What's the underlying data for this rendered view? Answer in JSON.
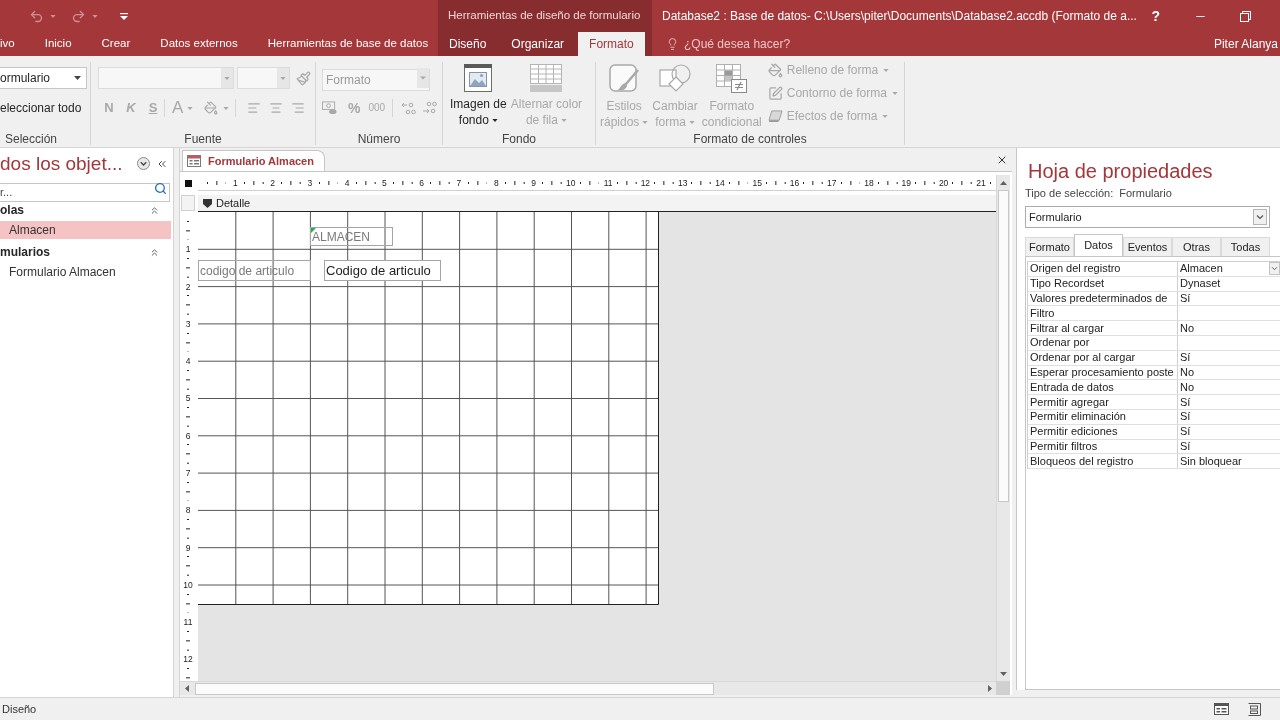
{
  "title_bar": {
    "context_group": "Herramientas de diseño de formulario",
    "title": "Database2 : Base de datos- C:\\Users\\piter\\Documents\\Database2.accdb (Formato de a...",
    "help": "?"
  },
  "tabs": [
    {
      "label": "ivo",
      "selected": false
    },
    {
      "label": "Inicio",
      "selected": false
    },
    {
      "label": "Crear",
      "selected": false
    },
    {
      "label": "Datos externos",
      "selected": false
    },
    {
      "label": "Herramientas de base de datos",
      "selected": false
    }
  ],
  "context_tabs": [
    {
      "label": "Diseño",
      "selected": false
    },
    {
      "label": "Organizar",
      "selected": false
    },
    {
      "label": "Formato",
      "selected": true
    }
  ],
  "tell_me": {
    "placeholder": "¿Qué desea hacer?"
  },
  "account": {
    "name": "Piter Alanya"
  },
  "ribbon_groups": [
    {
      "kind": "selection",
      "label": "Selección",
      "object_dropdown": "ormulario",
      "select_all": "eleccionar todo"
    },
    {
      "kind": "font",
      "label": "Fuente",
      "disabled": true,
      "style_buttons": [
        "N",
        "K",
        "S"
      ],
      "font_color": "A"
    },
    {
      "kind": "number",
      "label": "Número",
      "disabled": true,
      "format_field": {
        "placeholder": "Formato"
      },
      "percent": "%",
      "thousands": "000"
    },
    {
      "kind": "background",
      "label": "Fondo",
      "buttons": [
        {
          "lines": [
            "Imagen de",
            "fondo"
          ],
          "disabled": false,
          "dropdown": true
        },
        {
          "lines": [
            "Alternar color",
            "de fila"
          ],
          "disabled": true,
          "dropdown": true
        }
      ]
    },
    {
      "kind": "control_format",
      "label": "Formato de controles",
      "large_buttons": [
        {
          "lines": [
            "Estilos",
            "rápidos"
          ],
          "disabled": true,
          "dropdown": true
        },
        {
          "lines": [
            "Cambiar",
            "forma"
          ],
          "disabled": true,
          "dropdown": true
        },
        {
          "lines": [
            "Formato",
            "condicional"
          ],
          "disabled": true,
          "dropdown": false
        }
      ],
      "small_buttons": [
        {
          "label": "Relleno de forma",
          "disabled": true,
          "dropdown": true
        },
        {
          "label": "Contorno de forma",
          "disabled": true,
          "dropdown": true
        },
        {
          "label": "Efectos de forma",
          "disabled": true,
          "dropdown": true
        }
      ]
    }
  ],
  "nav_pane": {
    "title": "dos los objet...",
    "search": {
      "placeholder": "r..."
    },
    "groups": [
      {
        "label": "olas",
        "expanded": true,
        "items": [
          {
            "label": "Almacen",
            "selected": true
          }
        ]
      },
      {
        "label": "mularios",
        "expanded": true,
        "items": [
          {
            "label": "Formulario Almacen",
            "selected": false
          }
        ]
      }
    ]
  },
  "document": {
    "tabs": [
      {
        "label": "Formulario Almacen",
        "selected": true
      }
    ],
    "ruler": [
      "1",
      "2",
      "3",
      "4",
      "5",
      "6",
      "7",
      "8",
      "9",
      "10",
      "11",
      "12",
      "13",
      "14",
      "15",
      "16",
      "17",
      "18",
      "19",
      "20",
      "21"
    ],
    "vertical_ruler": [
      "1",
      "2",
      "3",
      "4",
      "5",
      "6",
      "7",
      "8",
      "9",
      "10",
      "11",
      "12"
    ],
    "section": "Detalle",
    "controls": [
      {
        "kind": "label",
        "text": "ALMACEN",
        "error_flag": true
      },
      {
        "kind": "label",
        "text": "codigo de articulo",
        "error_flag": false
      },
      {
        "kind": "textbox",
        "text": "Codigo de articulo",
        "error_flag": false
      }
    ]
  },
  "property_sheet": {
    "title": "Hoja de propiedades",
    "selection_type_label": "Tipo de selección:",
    "selection_type": "Formulario",
    "object_selector": "Formulario",
    "tabs": [
      {
        "label": "Formato",
        "selected": false
      },
      {
        "label": "Datos",
        "selected": true
      },
      {
        "label": "Eventos",
        "selected": false
      },
      {
        "label": "Otras",
        "selected": false
      },
      {
        "label": "Todas",
        "selected": false
      }
    ],
    "rows": [
      {
        "name": "Origen del registro",
        "value": "Almacen",
        "focused": true
      },
      {
        "name": "Tipo Recordset",
        "value": "Dynaset",
        "focused": false
      },
      {
        "name": "Valores predeterminados de",
        "value": "Sí",
        "focused": false
      },
      {
        "name": "Filtro",
        "focused": false
      },
      {
        "name": "Filtrar al cargar",
        "value": "No",
        "focused": false
      },
      {
        "name": "Ordenar por",
        "focused": false
      },
      {
        "name": "Ordenar por al cargar",
        "value": "Sí",
        "focused": false
      },
      {
        "name": "Esperar procesamiento poste",
        "value": "No",
        "focused": false
      },
      {
        "name": "Entrada de datos",
        "value": "No",
        "focused": false
      },
      {
        "name": "Permitir agregar",
        "value": "Sí",
        "focused": false
      },
      {
        "name": "Permitir eliminación",
        "value": "Sí",
        "focused": false
      },
      {
        "name": "Permitir ediciones",
        "value": "Sí",
        "focused": false
      },
      {
        "name": "Permitir filtros",
        "value": "Sí",
        "focused": false
      },
      {
        "name": "Bloqueos del registro",
        "value": "Sin bloquear",
        "focused": false
      }
    ]
  },
  "status_bar": {
    "mode": "Diseño"
  }
}
